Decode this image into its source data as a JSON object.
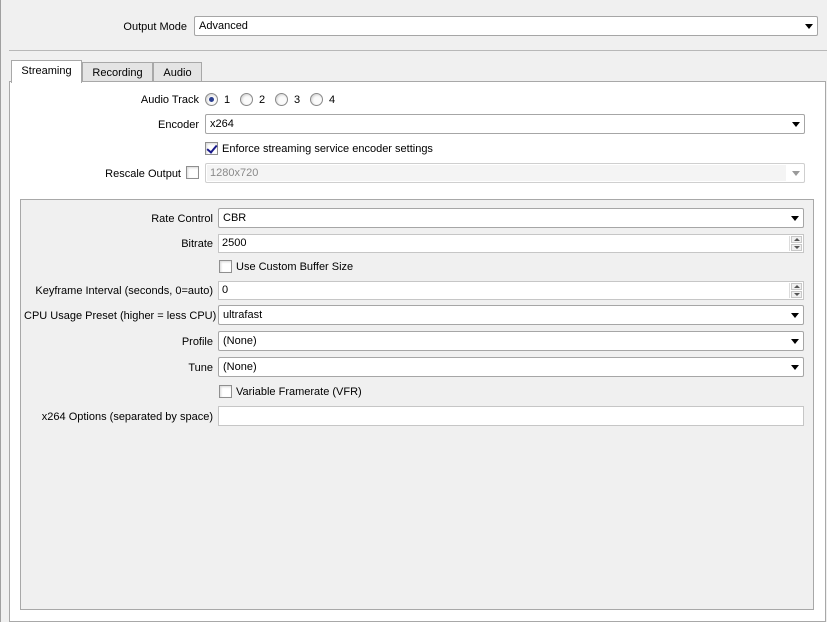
{
  "output_mode": {
    "label": "Output Mode",
    "value": "Advanced"
  },
  "tabs": [
    {
      "label": "Streaming",
      "active": true
    },
    {
      "label": "Recording",
      "active": false
    },
    {
      "label": "Audio",
      "active": false
    }
  ],
  "streaming": {
    "audio_track": {
      "label": "Audio Track",
      "options": [
        "1",
        "2",
        "3",
        "4"
      ],
      "selected": "1"
    },
    "encoder": {
      "label": "Encoder",
      "value": "x264"
    },
    "enforce": {
      "label": "Enforce streaming service encoder settings",
      "checked": true
    },
    "rescale": {
      "label": "Rescale Output",
      "checked": false,
      "value": "1280x720"
    }
  },
  "encoder_settings": {
    "rate_control": {
      "label": "Rate Control",
      "value": "CBR"
    },
    "bitrate": {
      "label": "Bitrate",
      "value": "2500"
    },
    "custom_buffer": {
      "label": "Use Custom Buffer Size",
      "checked": false
    },
    "keyframe": {
      "label": "Keyframe Interval (seconds, 0=auto)",
      "value": "0"
    },
    "cpu_preset": {
      "label": "CPU Usage Preset (higher = less CPU)",
      "value": "ultrafast"
    },
    "profile": {
      "label": "Profile",
      "value": "(None)"
    },
    "tune": {
      "label": "Tune",
      "value": "(None)"
    },
    "vfr": {
      "label": "Variable Framerate (VFR)",
      "checked": false
    },
    "x264_options": {
      "label": "x264 Options (separated by space)",
      "value": ""
    }
  }
}
